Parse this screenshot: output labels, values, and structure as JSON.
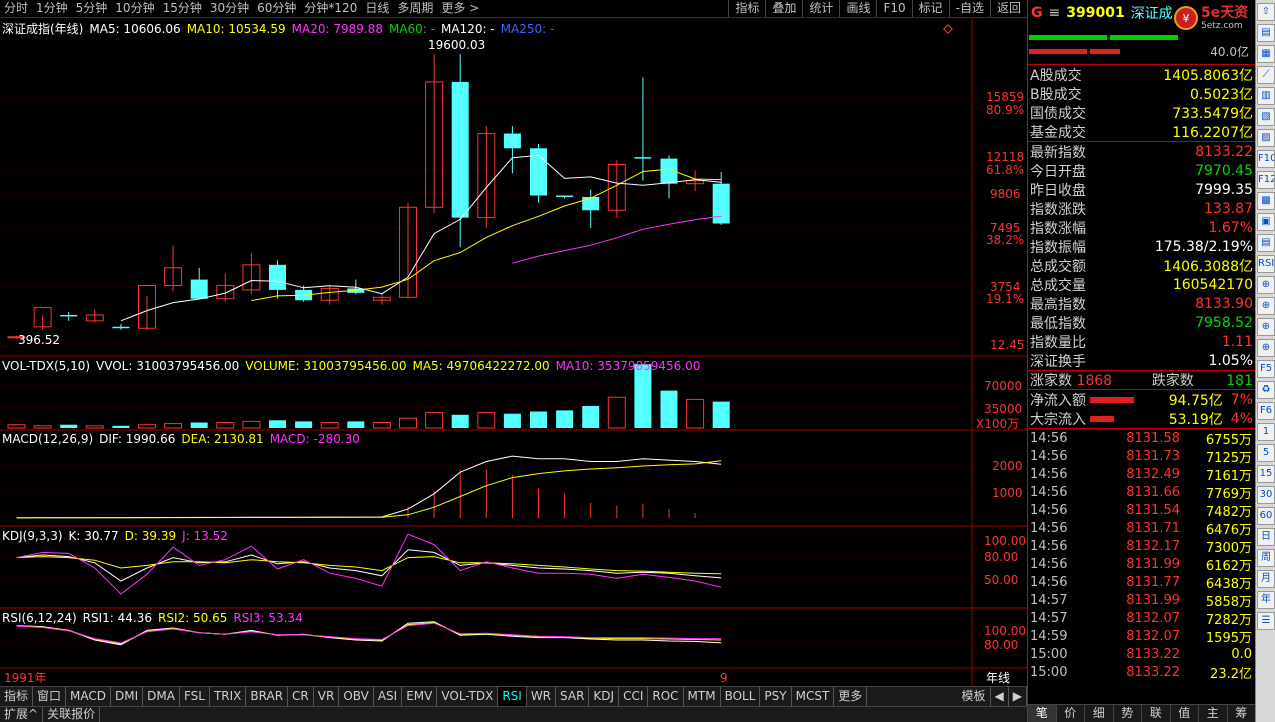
{
  "topbar": {
    "periods": [
      "分时",
      "1分钟",
      "5分钟",
      "10分钟",
      "15分钟",
      "30分钟",
      "60分钟",
      "分钟*120",
      "日线",
      "多周期",
      "更多 >"
    ],
    "tools": [
      "指标",
      "叠加",
      "统计",
      "画线",
      "F10",
      "标记",
      "-自选",
      "返回"
    ]
  },
  "main": {
    "title": "深证成指(年线)",
    "ma5": "MA5: 10606.06",
    "ma10": "MA10: 10534.59",
    "ma20": "MA20: 7989.88",
    "ma60": "MA60: -",
    "ma120": "MA120: -",
    "ma250": "MA250: -",
    "high_label": "19600.03",
    "low_label": "396.52",
    "yaxis": [
      "15859",
      "80.9%",
      "12118",
      "61.8%",
      "9806",
      "7495",
      "38.2%",
      "3754",
      "19.1%",
      "12.45"
    ],
    "candles": [
      {
        "o": 396,
        "h": 500,
        "l": 300,
        "c": 420
      },
      {
        "o": 1100,
        "h": 1900,
        "l": 900,
        "c": 2400
      },
      {
        "o": 1900,
        "h": 2100,
        "l": 1500,
        "c": 1800
      },
      {
        "o": 1500,
        "h": 2300,
        "l": 1400,
        "c": 1900
      },
      {
        "o": 1100,
        "h": 1300,
        "l": 900,
        "c": 1000
      },
      {
        "o": 1000,
        "h": 3200,
        "l": 900,
        "c": 3900
      },
      {
        "o": 3900,
        "h": 6600,
        "l": 3500,
        "c": 5100
      },
      {
        "o": 4300,
        "h": 5100,
        "l": 3300,
        "c": 3000
      },
      {
        "o": 3000,
        "h": 4700,
        "l": 2800,
        "c": 3900
      },
      {
        "o": 3600,
        "h": 6100,
        "l": 3300,
        "c": 5300
      },
      {
        "o": 5300,
        "h": 5600,
        "l": 3000,
        "c": 3600
      },
      {
        "o": 3600,
        "h": 3900,
        "l": 2800,
        "c": 2900
      },
      {
        "o": 2900,
        "h": 3900,
        "l": 2600,
        "c": 3700
      },
      {
        "o": 3700,
        "h": 4300,
        "l": 3300,
        "c": 3400
      },
      {
        "o": 2900,
        "h": 3300,
        "l": 2600,
        "c": 3100
      },
      {
        "o": 3100,
        "h": 9500,
        "l": 3000,
        "c": 9200
      },
      {
        "o": 9200,
        "h": 19600,
        "l": 8800,
        "c": 17700
      },
      {
        "o": 17700,
        "h": 19600,
        "l": 6500,
        "c": 8500
      },
      {
        "o": 8500,
        "h": 14700,
        "l": 7800,
        "c": 14200
      },
      {
        "o": 14200,
        "h": 14700,
        "l": 11500,
        "c": 13200
      },
      {
        "o": 13200,
        "h": 13500,
        "l": 9500,
        "c": 10000
      },
      {
        "o": 10000,
        "h": 10000,
        "l": 9800,
        "c": 9900
      },
      {
        "o": 9900,
        "h": 10400,
        "l": 7800,
        "c": 9000
      },
      {
        "o": 9000,
        "h": 12400,
        "l": 8500,
        "c": 12100
      },
      {
        "o": 12600,
        "h": 18000,
        "l": 11000,
        "c": 12500
      },
      {
        "o": 12500,
        "h": 12700,
        "l": 9800,
        "c": 10800
      },
      {
        "o": 10800,
        "h": 11700,
        "l": 10300,
        "c": 11000
      },
      {
        "o": 10800,
        "h": 11600,
        "l": 8000,
        "c": 8100
      }
    ],
    "candle_colors": {
      "up": "#ff3232",
      "down": "#54ffff"
    }
  },
  "vol": {
    "title": "VOL-TDX(5,10)",
    "vvol": "VVOL: 31003795456.00",
    "volume": "VOLUME: 31003795456.00",
    "ma5": "MA5: 49706422272.00",
    "ma10": "MA10: 35379859456.00",
    "yaxis": [
      "70000",
      "35000",
      "X100万"
    ]
  },
  "macd": {
    "title": "MACD(12,26,9)",
    "dif": "DIF: 1990.66",
    "dea": "DEA: 2130.81",
    "macd": "MACD: -280.30",
    "yaxis": [
      "2000",
      "1000"
    ]
  },
  "kdj": {
    "title": "KDJ(9,3,3)",
    "k": "K: 30.77",
    "d": "D: 39.39",
    "j": "J: 13.52",
    "yaxis": [
      "100.00",
      "80.00",
      "50.00"
    ]
  },
  "rsi": {
    "title": "RSI(6,12,24)",
    "rsi1": "RSI1: 44.36",
    "rsi2": "RSI2: 50.65",
    "rsi3": "RSI3: 53.34",
    "yaxis": [
      "100.00",
      "80.00"
    ]
  },
  "xaxis": {
    "start": "1991年",
    "end_mark": "9",
    "period": "年线"
  },
  "bottomtabs": [
    "指标",
    "窗口",
    "MACD",
    "DMI",
    "DMA",
    "FSL",
    "TRIX",
    "BRAR",
    "CR",
    "VR",
    "OBV",
    "ASI",
    "EMV",
    "VOL-TDX",
    "RSI",
    "WR",
    "SAR",
    "KDJ",
    "CCI",
    "ROC",
    "MTM",
    "BOLL",
    "PSY",
    "MCST",
    "更多"
  ],
  "bottom_right": [
    "模板",
    "◀",
    "▶"
  ],
  "statusbar": [
    "扩展^",
    "关联报价"
  ],
  "panel": {
    "g": "G",
    "menu": "≡",
    "code": "399001",
    "name": "深证成指",
    "logo": "5e天资",
    "logo_sub": "5etz.com",
    "bar_value": "40.0亿",
    "turnover": [
      {
        "label": "A股成交",
        "value": "1405.8063亿"
      },
      {
        "label": "B股成交",
        "value": "0.5023亿"
      },
      {
        "label": "国债成交",
        "value": "733.5479亿"
      },
      {
        "label": "基金成交",
        "value": "116.2207亿"
      }
    ],
    "stats": [
      {
        "label": "最新指数",
        "value": "8133.22",
        "color": "red"
      },
      {
        "label": "今日开盘",
        "value": "7970.45",
        "color": "green"
      },
      {
        "label": "昨日收盘",
        "value": "7999.35",
        "color": "white"
      },
      {
        "label": "指数涨跌",
        "value": "133.87",
        "color": "red"
      },
      {
        "label": "指数涨幅",
        "value": "1.67%",
        "color": "red"
      },
      {
        "label": "指数振幅",
        "value": "175.38/2.19%",
        "color": "white"
      },
      {
        "label": "总成交额",
        "value": "1406.3088亿",
        "color": "yellow"
      },
      {
        "label": "总成交量",
        "value": "160542170",
        "color": "yellow"
      },
      {
        "label": "最高指数",
        "value": "8133.90",
        "color": "red"
      },
      {
        "label": "最低指数",
        "value": "7958.52",
        "color": "green"
      },
      {
        "label": "指数量比",
        "value": "1.11",
        "color": "red"
      },
      {
        "label": "深证换手",
        "value": "1.05%",
        "color": "white"
      }
    ],
    "rise_label": "涨家数",
    "rise_value": "1868",
    "fall_label": "跌家数",
    "fall_value": "181",
    "flows": [
      {
        "label": "净流入额",
        "value": "94.75亿",
        "pct": "7%"
      },
      {
        "label": "大宗流入",
        "value": "53.19亿",
        "pct": "4%"
      }
    ],
    "ticks": [
      {
        "t": "14:56",
        "p": "8131.58",
        "v": "6755万"
      },
      {
        "t": "14:56",
        "p": "8131.73",
        "v": "7125万"
      },
      {
        "t": "14:56",
        "p": "8132.49",
        "v": "7161万"
      },
      {
        "t": "14:56",
        "p": "8131.66",
        "v": "7769万"
      },
      {
        "t": "14:56",
        "p": "8131.54",
        "v": "7482万"
      },
      {
        "t": "14:56",
        "p": "8131.71",
        "v": "6476万"
      },
      {
        "t": "14:56",
        "p": "8132.17",
        "v": "7300万"
      },
      {
        "t": "14:56",
        "p": "8131.99",
        "v": "6162万"
      },
      {
        "t": "14:56",
        "p": "8131.77",
        "v": "6438万"
      },
      {
        "t": "14:57",
        "p": "8131.99",
        "v": "5858万"
      },
      {
        "t": "14:57",
        "p": "8132.07",
        "v": "7282万"
      },
      {
        "t": "14:59",
        "p": "8132.07",
        "v": "1595万"
      },
      {
        "t": "15:00",
        "p": "8133.22",
        "v": "0.0"
      },
      {
        "t": "15:00",
        "p": "8133.22",
        "v": "23.2亿"
      }
    ],
    "bottom_tabs": [
      "笔",
      "价",
      "细",
      "势",
      "联",
      "值",
      "主",
      "筹"
    ]
  },
  "sidebar": [
    "⇧",
    "▤",
    "▦",
    "⟋",
    "▥",
    "▧",
    "▨",
    "F10",
    "F12",
    "▩",
    "▣",
    "▤",
    "RSI",
    "⊕",
    "⊕",
    "⊕",
    "⊕",
    "F5",
    "♻",
    "F6",
    "1",
    "5",
    "15",
    "30",
    "60",
    "日",
    "周",
    "月",
    "年",
    "☰"
  ]
}
